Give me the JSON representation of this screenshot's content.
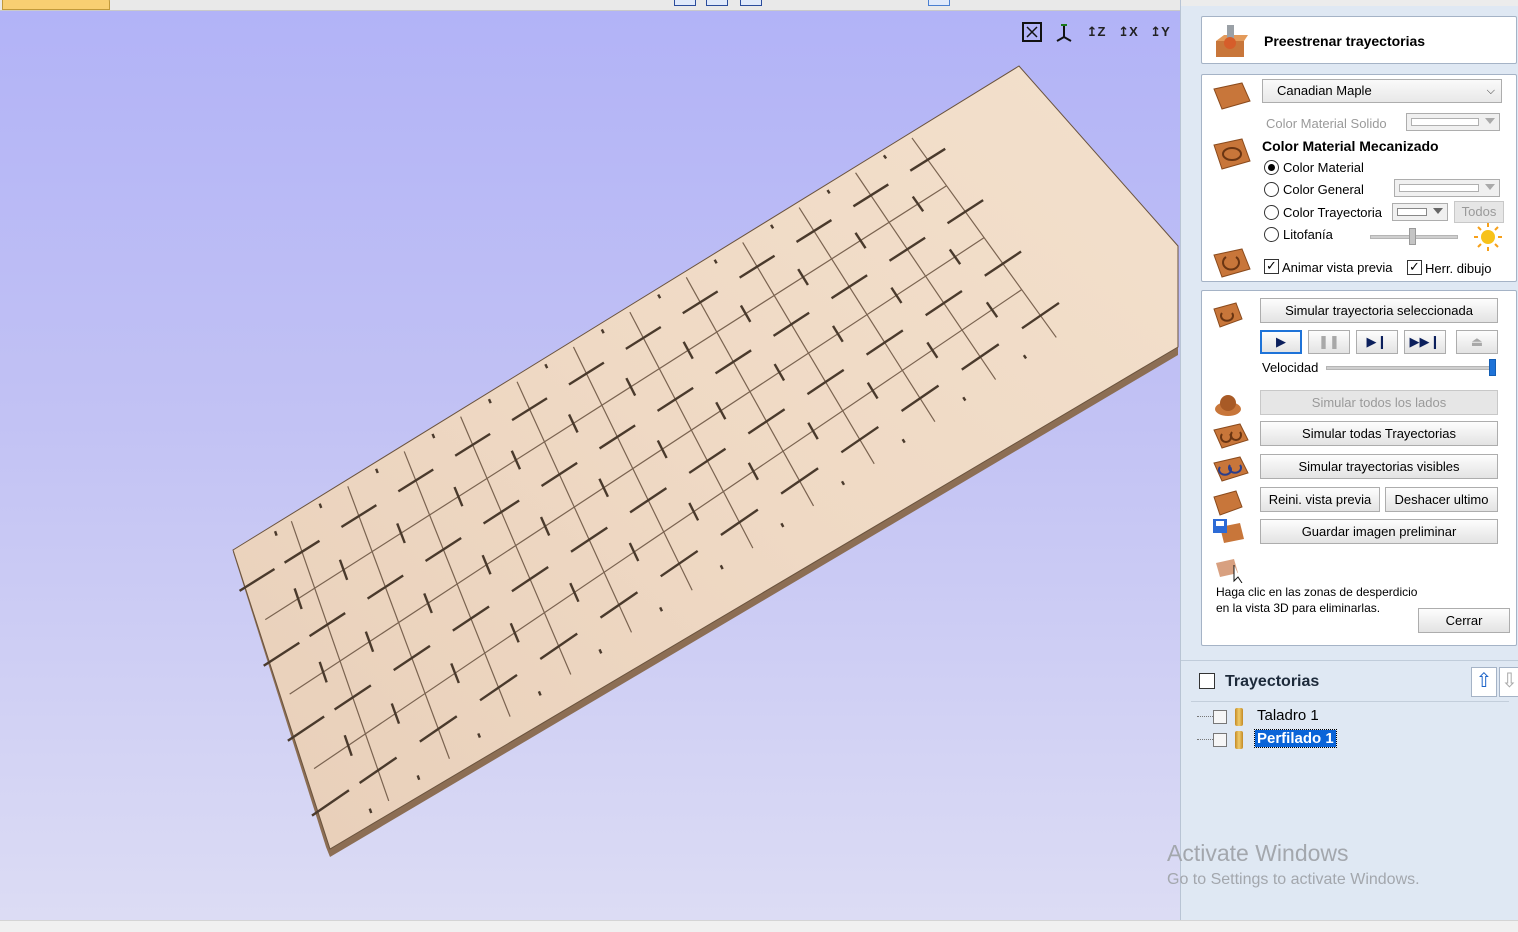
{
  "panel": {
    "title": "Preestrenar trayectorias",
    "material": {
      "selected": "Canadian Maple",
      "solid_color_label": "Color Material Solido",
      "machined_heading": "Color Material Mecanizado",
      "options": [
        "Color Material",
        "Color General",
        "Color Trayectoria",
        "Litofanía"
      ],
      "selected_option": "Color Material",
      "todos_label": "Todos",
      "animate_label": "Animar vista previa",
      "animate_checked": true,
      "draw_tool_label": "Herr. dibujo",
      "draw_tool_checked": true
    },
    "simulation": {
      "simulate_selected": "Simular trayectoria seleccionada",
      "speed_label": "Velocidad",
      "speed_level": 1.0,
      "simulate_all_sides": "Simular todos los lados",
      "simulate_all": "Simular todas Trayectorias",
      "simulate_visible": "Simular trayectorias visibles",
      "reset_preview": "Reini. vista previa",
      "undo_last": "Deshacer ultimo",
      "save_image": "Guardar imagen preliminar",
      "hint_line1": "Haga clic en las zonas de desperdicio",
      "hint_line2": "en la vista 3D para eliminarlas.",
      "close": "Cerrar"
    }
  },
  "toolpaths": {
    "title": "Trayectorias",
    "items": [
      {
        "name": "Taladro 1",
        "selected": false
      },
      {
        "name": "Perfilado 1",
        "selected": true
      }
    ]
  },
  "viewport": {
    "view_buttons": [
      "fit-view",
      "iso-view",
      "Z",
      "X",
      "Y"
    ],
    "colors": {
      "background_top": "#b2b3f7",
      "background_bottom": "#dcdcf4",
      "material": "#ecd4bd",
      "slot": "#4a3a2c"
    }
  },
  "watermark": {
    "line1": "Activate Windows",
    "line2": "Go to Settings to activate Windows."
  }
}
